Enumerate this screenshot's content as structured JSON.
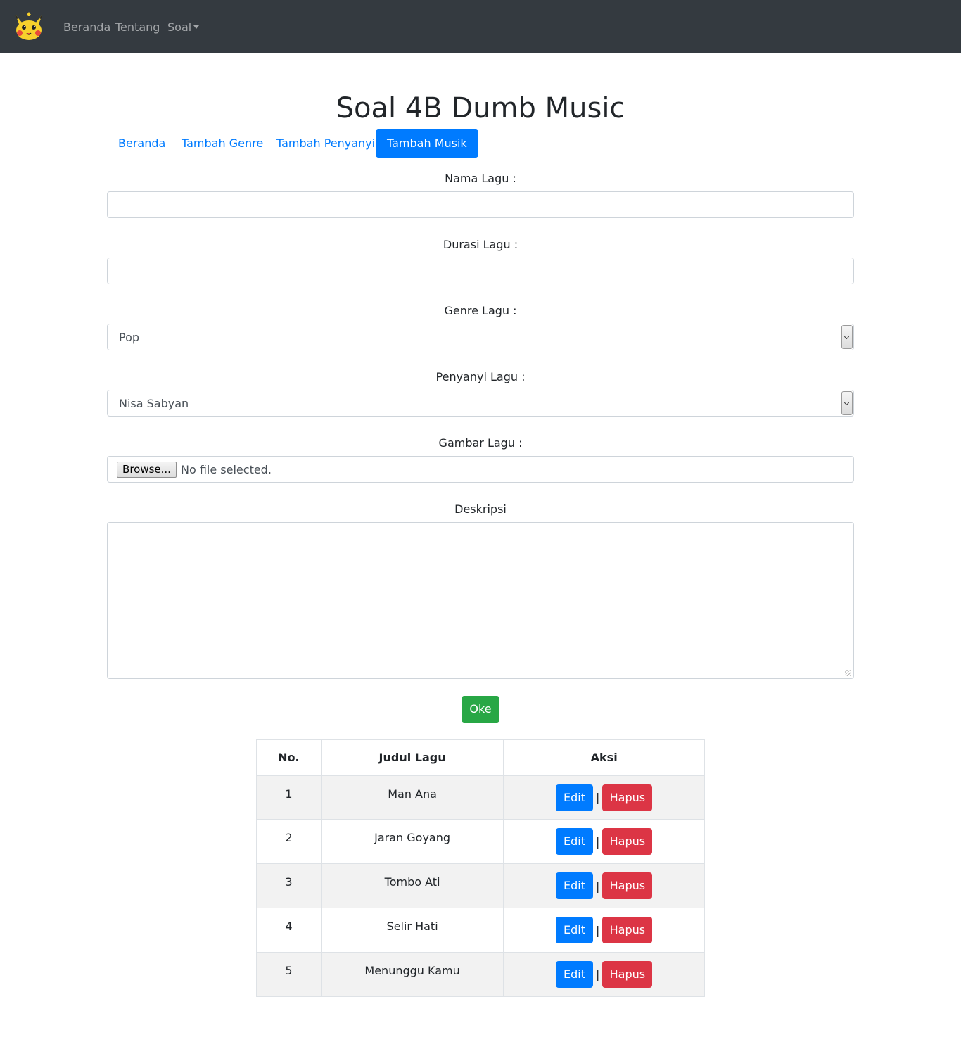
{
  "navbar": {
    "logo_icon": "pikachu-logo-icon",
    "links": [
      "Beranda",
      "Tentang",
      "Soal"
    ]
  },
  "page": {
    "title": "Soal 4B Dumb Music"
  },
  "tabs": [
    {
      "label": "Beranda",
      "active": false
    },
    {
      "label": "Tambah Genre",
      "active": false
    },
    {
      "label": "Tambah Penyanyi",
      "active": false
    },
    {
      "label": "Tambah Musik",
      "active": true
    }
  ],
  "form": {
    "nama_label": "Nama Lagu :",
    "nama_value": "",
    "durasi_label": "Durasi Lagu :",
    "durasi_value": "",
    "genre_label": "Genre Lagu :",
    "genre_selected": "Pop",
    "penyanyi_label": "Penyanyi Lagu :",
    "penyanyi_selected": "Nisa Sabyan",
    "gambar_label": "Gambar Lagu :",
    "browse_label": "Browse...",
    "file_status": "No file selected.",
    "deskripsi_label": "Deskripsi",
    "deskripsi_value": "",
    "submit_label": "Oke"
  },
  "table": {
    "headers": [
      "No.",
      "Judul Lagu",
      "Aksi"
    ],
    "rows": [
      {
        "no": "1",
        "judul": "Man Ana"
      },
      {
        "no": "2",
        "judul": "Jaran Goyang"
      },
      {
        "no": "3",
        "judul": "Tombo Ati"
      },
      {
        "no": "4",
        "judul": "Selir Hati"
      },
      {
        "no": "5",
        "judul": "Menunggu Kamu"
      }
    ],
    "edit_label": "Edit",
    "hapus_label": "Hapus",
    "separator": "|"
  },
  "colors": {
    "navbar": "#343a40",
    "primary": "#007bff",
    "success": "#28a745",
    "danger": "#dc3545"
  }
}
